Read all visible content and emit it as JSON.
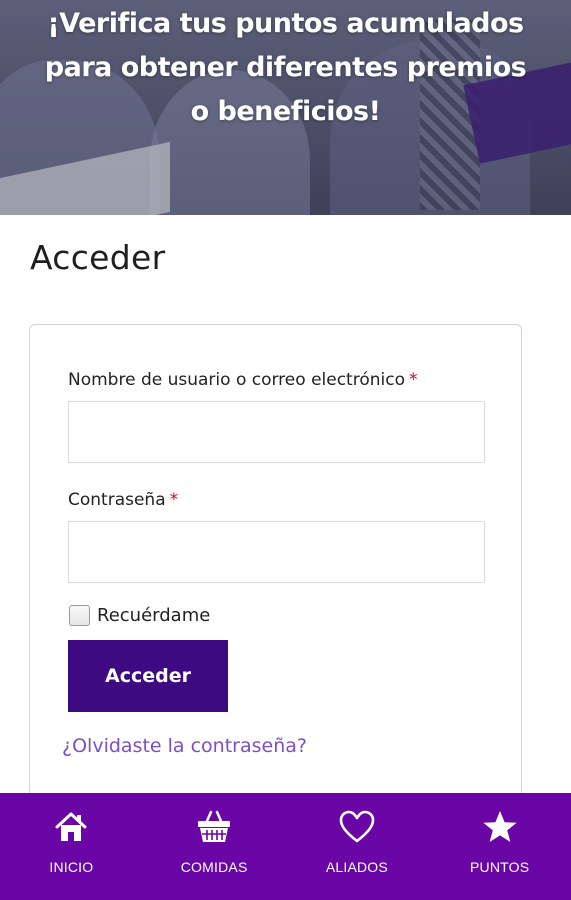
{
  "hero": {
    "lines": [
      "¡Verifica tus puntos acumulados",
      "para obtener diferentes premios",
      "o beneficios!"
    ]
  },
  "page": {
    "title": "Acceder"
  },
  "login": {
    "username_label": "Nombre de usuario o correo electrónico",
    "password_label": "Contraseña",
    "required_mark": "*",
    "username_value": "",
    "password_value": "",
    "remember_label": "Recuérdame",
    "remember_checked": false,
    "submit_label": "Acceder",
    "lost_password": "¿Olvidaste la contraseña?"
  },
  "nav": {
    "items": [
      {
        "label": "INICIO",
        "icon": "home-icon"
      },
      {
        "label": "COMIDAS",
        "icon": "basket-icon"
      },
      {
        "label": "ALIADOS",
        "icon": "heart-icon"
      },
      {
        "label": "PUNTOS",
        "icon": "star-icon"
      }
    ]
  },
  "colors": {
    "brand_purple": "#6a06a5",
    "button_purple": "#3d0a82",
    "link_purple": "#7d4fc6",
    "required_red": "#d0021b"
  }
}
